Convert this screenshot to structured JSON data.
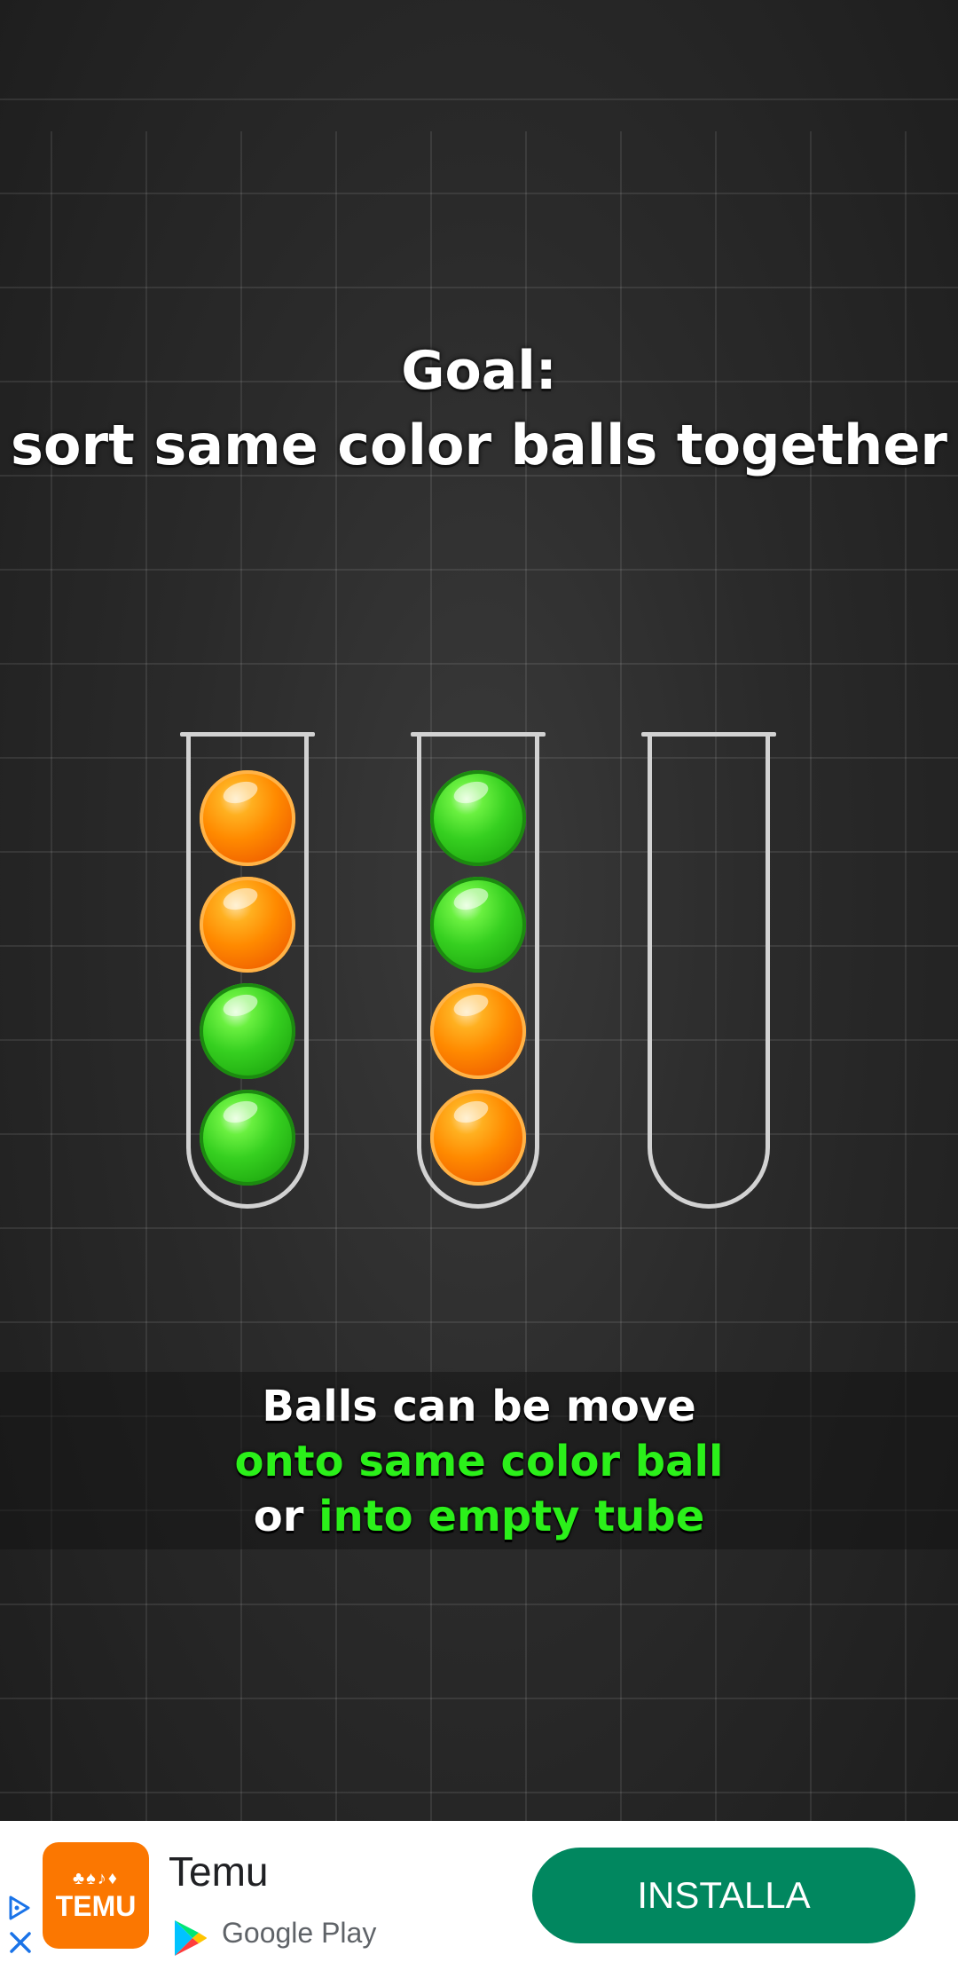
{
  "tutorial": {
    "goal_title": "Goal:",
    "goal_subtitle": "sort same color balls together",
    "hint": {
      "line1": "Balls can be move",
      "line2": "onto same color ball",
      "line3_prefix": "or ",
      "line3_highlight": "into empty tube"
    }
  },
  "tubes": [
    {
      "name": "tube-1",
      "balls_top_to_bottom": [
        "orange",
        "orange",
        "green",
        "green"
      ]
    },
    {
      "name": "tube-2",
      "balls_top_to_bottom": [
        "green",
        "green",
        "orange",
        "orange"
      ]
    },
    {
      "name": "tube-3",
      "balls_top_to_bottom": []
    }
  ],
  "colors": {
    "orange": "#ff8a00",
    "green": "#36d020",
    "highlight_text": "#2bf01a",
    "install_button": "#01875f",
    "temu_brand": "#fb7701"
  },
  "ad": {
    "logo_text": "TEMU",
    "logo_icons": "♣♠♪♦",
    "app_name": "Temu",
    "store_name": "Google Play",
    "install_label": "INSTALLA",
    "adchoices_icon": "adchoices-icon",
    "close_icon": "close-icon"
  }
}
